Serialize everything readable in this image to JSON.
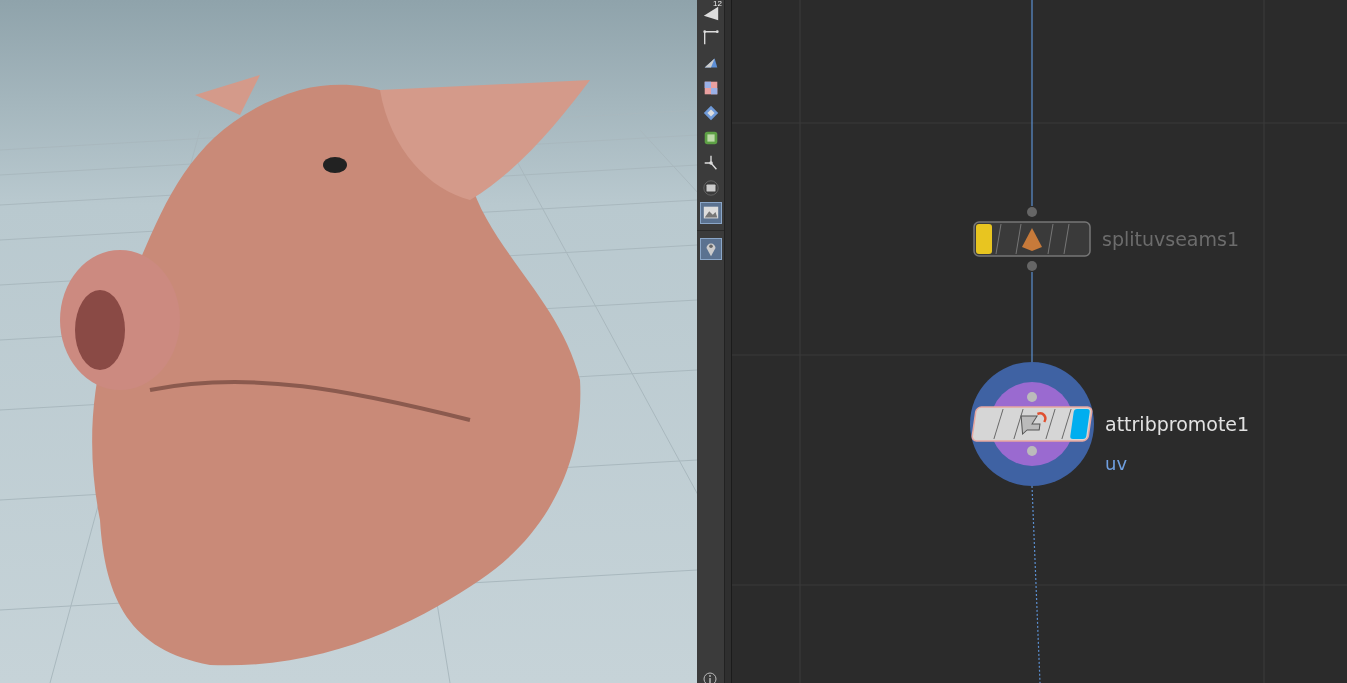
{
  "toolbar": {
    "tools": [
      {
        "kind": "frustum",
        "label": "12",
        "selected": false
      },
      {
        "kind": "corner",
        "selected": false
      },
      {
        "kind": "wedge",
        "selected": false
      },
      {
        "kind": "checker",
        "selected": false
      },
      {
        "kind": "diamond",
        "selected": false
      },
      {
        "kind": "framed-square",
        "selected": false
      },
      {
        "kind": "tripod",
        "selected": false
      },
      {
        "kind": "disc",
        "selected": false
      },
      {
        "kind": "image",
        "selected": true
      },
      {
        "kind": "pin",
        "selected": true
      }
    ]
  },
  "network": {
    "nodes": [
      {
        "name": "splituvseams1",
        "bypass": true,
        "display": false
      },
      {
        "name": "attribpromote1",
        "subtitle": "uv",
        "bypass": false,
        "display": true
      }
    ]
  }
}
